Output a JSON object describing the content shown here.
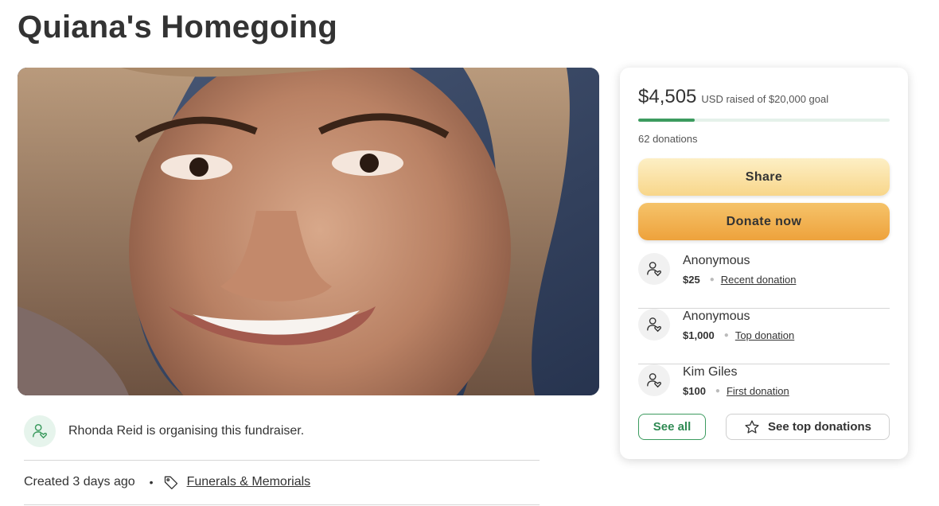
{
  "page": {
    "title": "Quiana's Homegoing"
  },
  "organiser": {
    "text": "Rhonda Reid is organising this fundraiser.",
    "icon": "user-heart-icon"
  },
  "meta": {
    "created": "Created 3 days ago",
    "separator": "•",
    "category": "Funerals & Memorials",
    "category_icon": "tag-icon"
  },
  "donation_card": {
    "raised_amount": "$4,505",
    "goal_text": "USD raised of $20,000 goal",
    "progress_fraction": 0.225,
    "donation_count": "62 donations",
    "share_label": "Share",
    "donate_label": "Donate now",
    "donations": [
      {
        "name": "Anonymous",
        "amount": "$25",
        "label": "Recent donation"
      },
      {
        "name": "Anonymous",
        "amount": "$1,000",
        "label": "Top donation"
      },
      {
        "name": "Kim Giles",
        "amount": "$100",
        "label": "First donation"
      }
    ],
    "see_all_label": "See all",
    "see_top_label": "See top donations"
  },
  "colors": {
    "accent_green": "#3c9b5f",
    "share_button": "#f8d68a",
    "donate_button": "#eea23c"
  }
}
